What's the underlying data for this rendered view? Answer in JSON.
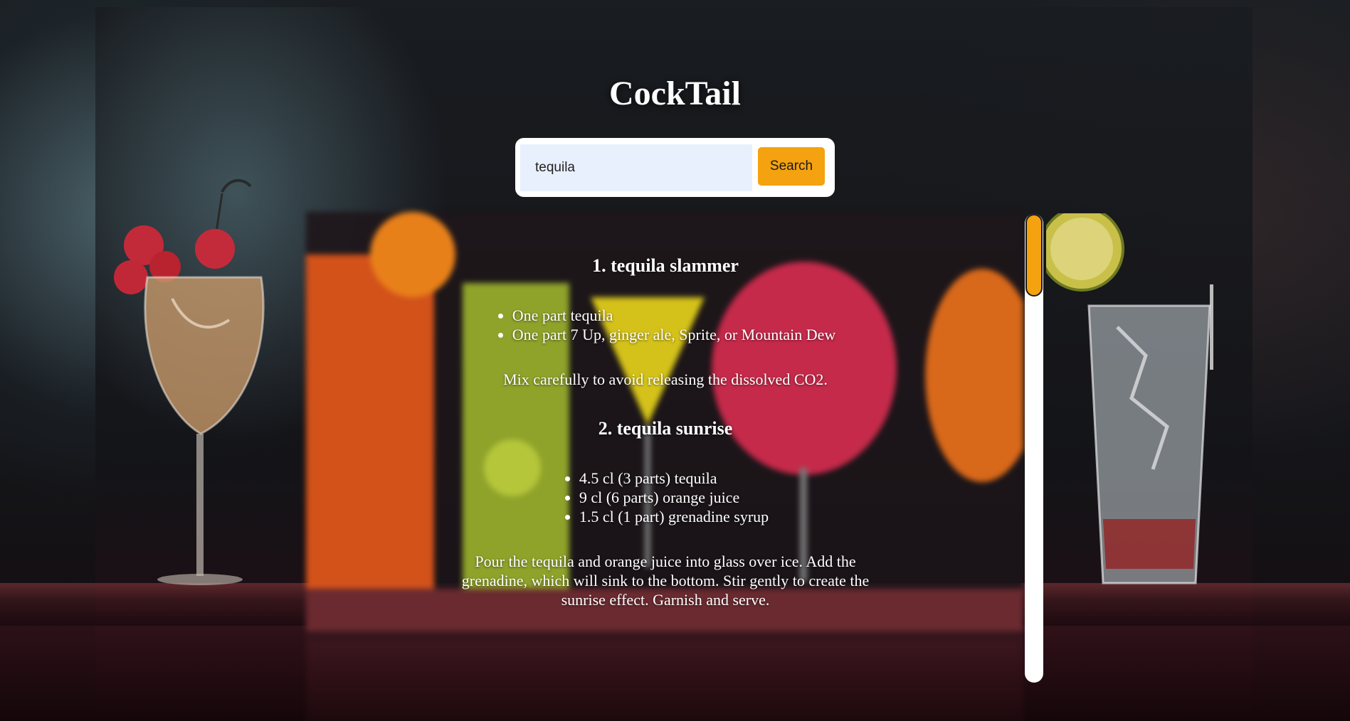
{
  "app": {
    "title": "CockTail"
  },
  "search": {
    "value": "tequila",
    "button_label": "Search"
  },
  "results": [
    {
      "title": "1. tequila slammer",
      "ingredients": [
        "One part tequila",
        "One part 7 Up, ginger ale, Sprite, or Mountain Dew"
      ],
      "instructions": "Mix carefully to avoid releasing the dissolved CO2."
    },
    {
      "title": "2. tequila sunrise",
      "ingredients": [
        "4.5 cl (3 parts) tequila",
        "9 cl (6 parts) orange juice",
        "1.5 cl (1 part) grenadine syrup"
      ],
      "instructions": "Pour the tequila and orange juice into glass over ice. Add the grenadine, which will sink to the bottom. Stir gently to create the sunrise effect. Garnish and serve."
    }
  ],
  "scrollbar": {
    "position": 0
  },
  "colors": {
    "accent": "#f4a20f",
    "input_bg": "#e8f0fe",
    "text": "#ffffff"
  }
}
